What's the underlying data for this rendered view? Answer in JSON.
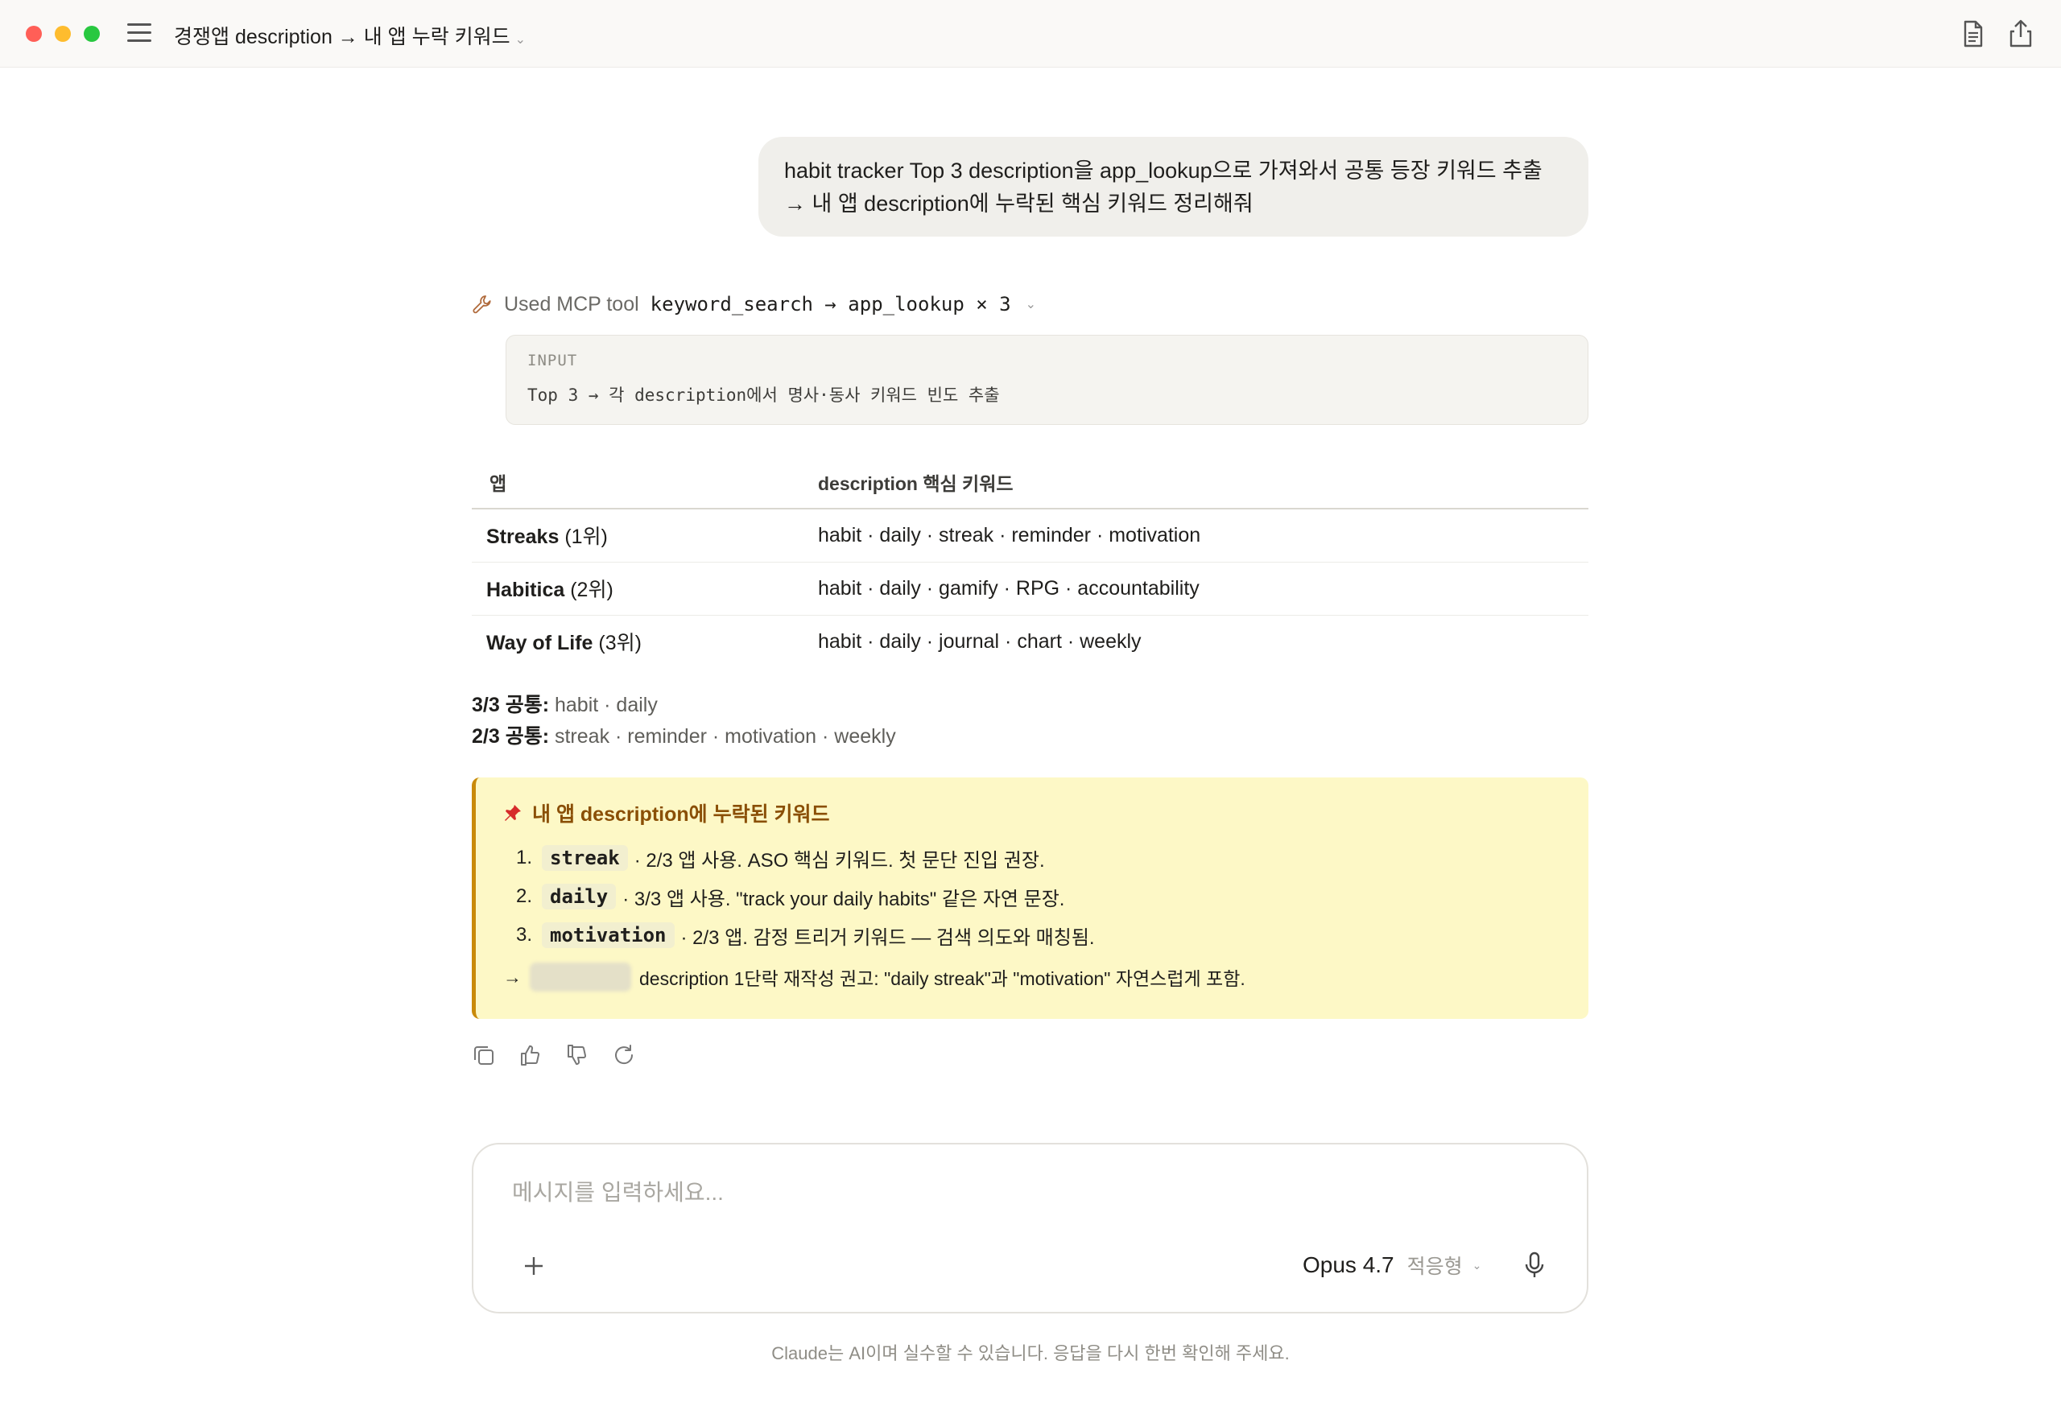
{
  "window": {
    "title": "경쟁앱 description → 내 앱 누락 키워드"
  },
  "user_message": {
    "line1": "habit tracker Top 3 description을 app_lookup으로 가져와서 공통 등장 키워드 추출",
    "line2": "→ 내 앱 description에 누락된 핵심 키워드 정리해줘"
  },
  "tool_use": {
    "prefix": "Used MCP tool",
    "tools": "keyword_search → app_lookup × 3",
    "input_label": "INPUT",
    "input_value": "Top 3 → 각 description에서 명사·동사 키워드 빈도 추출"
  },
  "table": {
    "headers": [
      "앱",
      "description 핵심 키워드"
    ],
    "rows": [
      {
        "app": "Streaks",
        "rank": "(1위)",
        "keywords": "habit · daily · streak · reminder · motivation"
      },
      {
        "app": "Habitica",
        "rank": "(2위)",
        "keywords": "habit · daily · gamify · RPG · accountability"
      },
      {
        "app": "Way of Life",
        "rank": "(3위)",
        "keywords": "habit · daily · journal · chart · weekly"
      }
    ]
  },
  "common": {
    "c1_label": "3/3 공통:",
    "c1_value": "habit · daily",
    "c2_label": "2/3 공통:",
    "c2_value": "streak · reminder · motivation · weekly"
  },
  "callout": {
    "icon": "pin-icon",
    "title": "내 앱 description에 누락된 키워드",
    "items": [
      {
        "num": "1.",
        "keyword": "streak",
        "desc": "· 2/3 앱 사용. ASO 핵심 키워드. 첫 문단 진입 권장."
      },
      {
        "num": "2.",
        "keyword": "daily",
        "desc": "· 3/3 앱 사용. \"track your daily habits\" 같은 자연 문장."
      },
      {
        "num": "3.",
        "keyword": "motivation",
        "desc": "· 2/3 앱. 감정 트리거 키워드 — 검색 의도와 매칭됨."
      }
    ],
    "tip_arrow": "→",
    "tip_text": "description 1단락 재작성 권고: \"daily streak\"과 \"motivation\" 자연스럽게 포함.",
    "accent": "#c98a0a",
    "background": "#fdf8c6"
  },
  "composer": {
    "placeholder": "메시지를 입력하세요...",
    "model_name": "Opus 4.7",
    "model_mode": "적응형"
  },
  "disclaimer": "Claude는 AI이며 실수할 수 있습니다. 응답을 다시 한번 확인해 주세요."
}
